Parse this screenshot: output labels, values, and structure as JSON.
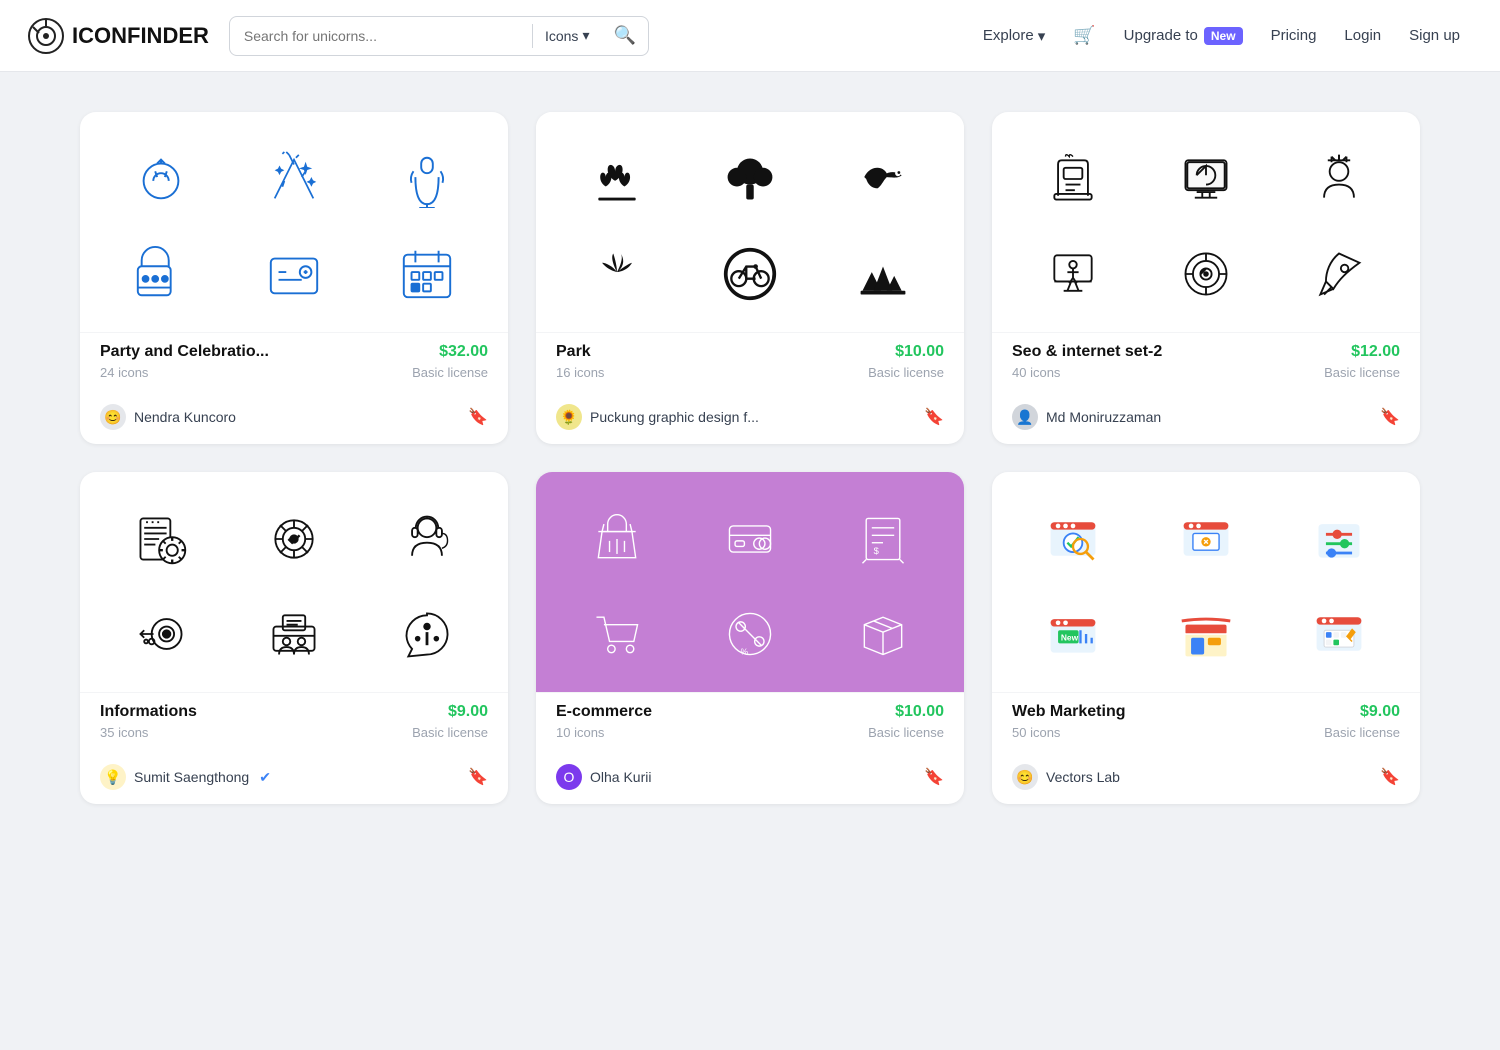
{
  "header": {
    "logo_text": "ICONFINDER",
    "search_placeholder": "Search for unicorns...",
    "search_type": "Icons",
    "explore_label": "Explore",
    "upgrade_label": "Upgrade to",
    "new_badge": "New",
    "pricing_label": "Pricing",
    "login_label": "Login",
    "signup_label": "Sign up"
  },
  "cards": [
    {
      "id": "party",
      "title": "Party and Celebratio...",
      "price": "$32.00",
      "count": "24 icons",
      "license": "Basic license",
      "author": "Nendra Kuncoro",
      "author_verified": false,
      "bg": "white"
    },
    {
      "id": "park",
      "title": "Park",
      "price": "$10.00",
      "count": "16 icons",
      "license": "Basic license",
      "author": "Puckung graphic design f...",
      "author_verified": false,
      "bg": "white"
    },
    {
      "id": "seo",
      "title": "Seo & internet set-2",
      "price": "$12.00",
      "count": "40 icons",
      "license": "Basic license",
      "author": "Md Moniruzzaman",
      "author_verified": false,
      "bg": "white"
    },
    {
      "id": "informations",
      "title": "Informations",
      "price": "$9.00",
      "count": "35 icons",
      "license": "Basic license",
      "author": "Sumit Saengthong",
      "author_verified": true,
      "bg": "white"
    },
    {
      "id": "ecommerce",
      "title": "E-commerce",
      "price": "$10.00",
      "count": "10 icons",
      "license": "Basic license",
      "author": "Olha Kurii",
      "author_verified": false,
      "bg": "purple"
    },
    {
      "id": "webmarketing",
      "title": "Web Marketing",
      "price": "$9.00",
      "count": "50 icons",
      "license": "Basic license",
      "author": "Vectors Lab",
      "author_verified": false,
      "bg": "white"
    }
  ]
}
